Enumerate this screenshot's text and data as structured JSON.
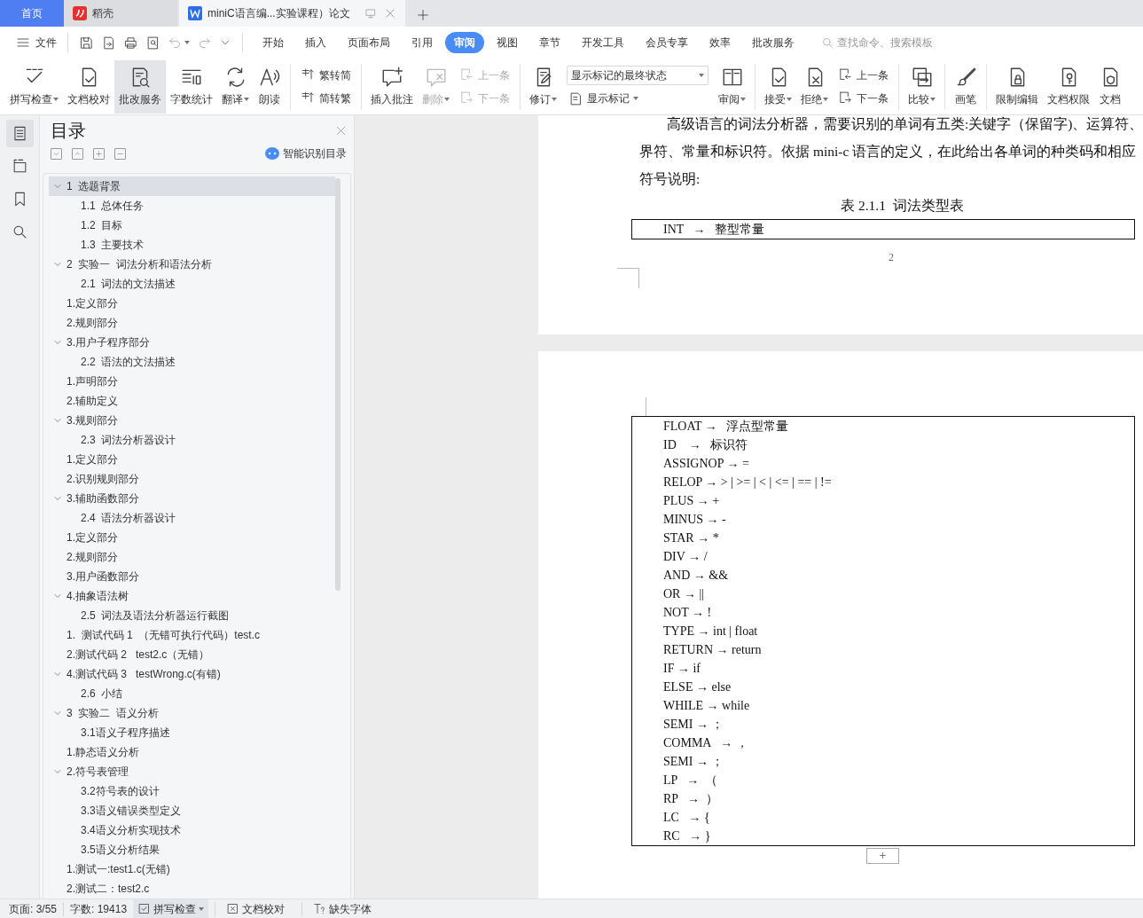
{
  "tabs": [
    {
      "kind": "home",
      "label": "首页",
      "selected": false
    },
    {
      "kind": "app",
      "label": "稻壳",
      "selected": false
    },
    {
      "kind": "doc",
      "label": "miniC语言编...实验课程）论文",
      "selected": true
    }
  ],
  "menu": {
    "file": "文件",
    "items": [
      {
        "label": "开始",
        "selected": false
      },
      {
        "label": "插入",
        "selected": false
      },
      {
        "label": "页面布局",
        "selected": false
      },
      {
        "label": "引用",
        "selected": false
      },
      {
        "label": "审阅",
        "selected": true
      },
      {
        "label": "视图",
        "selected": false
      },
      {
        "label": "章节",
        "selected": false
      },
      {
        "label": "开发工具",
        "selected": false
      },
      {
        "label": "会员专享",
        "selected": false
      },
      {
        "label": "效率",
        "selected": false
      },
      {
        "label": "批改服务",
        "selected": false
      }
    ],
    "search": {
      "placeholder": "查找命令、搜索模板"
    }
  },
  "ribbon": [
    {
      "kind": "large",
      "label": "拼写检查",
      "dropdown": true,
      "disabled": false,
      "selected": false
    },
    {
      "kind": "large",
      "label": "文档校对",
      "dropdown": false,
      "disabled": false,
      "selected": false
    },
    {
      "kind": "large",
      "label": "批改服务",
      "dropdown": false,
      "disabled": false,
      "selected": true
    },
    {
      "kind": "large",
      "label": "字数统计",
      "dropdown": false,
      "disabled": false,
      "selected": false
    },
    {
      "kind": "large",
      "label": "翻译",
      "dropdown": true,
      "disabled": false,
      "selected": false
    },
    {
      "kind": "large",
      "label": "朗读",
      "dropdown": false,
      "disabled": false,
      "selected": false
    },
    {
      "kind": "separator"
    },
    {
      "kind": "pair",
      "items": [
        {
          "label": "繁转简",
          "disabled": false
        },
        {
          "label": "简转繁",
          "disabled": false
        }
      ]
    },
    {
      "kind": "separator"
    },
    {
      "kind": "large",
      "label": "插入批注",
      "dropdown": false,
      "disabled": false,
      "selected": false
    },
    {
      "kind": "large",
      "label": "删除",
      "dropdown": true,
      "disabled": true,
      "selected": false
    },
    {
      "kind": "pair",
      "items": [
        {
          "label": "上一条",
          "disabled": true
        },
        {
          "label": "下一条",
          "disabled": true
        }
      ]
    },
    {
      "kind": "separator"
    },
    {
      "kind": "large",
      "label": "修订",
      "dropdown": true,
      "disabled": false,
      "selected": false
    },
    {
      "kind": "select",
      "value": "显示标记的最终状态",
      "label": "显示标记",
      "dropdown": true
    },
    {
      "kind": "large",
      "label": "审阅",
      "dropdown": true,
      "disabled": false,
      "selected": false
    },
    {
      "kind": "separator"
    },
    {
      "kind": "large",
      "label": "接受",
      "dropdown": true,
      "disabled": false,
      "selected": false
    },
    {
      "kind": "large",
      "label": "拒绝",
      "dropdown": true,
      "disabled": false,
      "selected": false
    },
    {
      "kind": "pair",
      "items": [
        {
          "label": "上一条",
          "disabled": false
        },
        {
          "label": "下一条",
          "disabled": false
        }
      ]
    },
    {
      "kind": "separator"
    },
    {
      "kind": "large",
      "label": "比较",
      "dropdown": true,
      "disabled": false,
      "selected": false
    },
    {
      "kind": "separator"
    },
    {
      "kind": "large",
      "label": "画笔",
      "dropdown": false,
      "disabled": false,
      "selected": false
    },
    {
      "kind": "separator"
    },
    {
      "kind": "large",
      "label": "限制编辑",
      "dropdown": false,
      "disabled": false,
      "selected": false
    },
    {
      "kind": "large",
      "label": "文档权限",
      "dropdown": false,
      "disabled": false,
      "selected": false
    },
    {
      "kind": "large",
      "label": "文档",
      "dropdown": false,
      "disabled": false,
      "selected": false
    }
  ],
  "side_icons": [
    {
      "selected": true
    },
    {
      "selected": false
    },
    {
      "selected": false
    },
    {
      "selected": false
    }
  ],
  "toc": {
    "title": "目录",
    "smart_button": "智能识别目录",
    "items": [
      {
        "label": "1  选题背景",
        "selected": true,
        "expanded": true,
        "children": [
          {
            "label": "1.1  总体任务",
            "selected": false
          },
          {
            "label": "1.2  目标",
            "selected": false
          },
          {
            "label": "1.3  主要技术",
            "selected": false
          }
        ]
      },
      {
        "label": "2  实验一  词法分析和语法分析",
        "selected": false,
        "expanded": true,
        "children": [
          {
            "label": "2.1  词法的文法描述",
            "selected": false
          }
        ]
      },
      {
        "label": "1.定义部分",
        "selected": false
      },
      {
        "label": "2.规则部分",
        "selected": false
      },
      {
        "label": "3.用户子程序部分",
        "selected": false,
        "expanded": true,
        "children": [
          {
            "label": "2.2  语法的文法描述",
            "selected": false
          }
        ]
      },
      {
        "label": "1.声明部分",
        "selected": false
      },
      {
        "label": "2.辅助定义",
        "selected": false
      },
      {
        "label": "3.规则部分",
        "selected": false,
        "expanded": true,
        "children": [
          {
            "label": "2.3  词法分析器设计",
            "selected": false
          }
        ]
      },
      {
        "label": "1.定义部分",
        "selected": false
      },
      {
        "label": "2.识别规则部分",
        "selected": false
      },
      {
        "label": "3.辅助函数部分",
        "selected": false,
        "expanded": true,
        "children": [
          {
            "label": "2.4  语法分析器设计",
            "selected": false
          }
        ]
      },
      {
        "label": "1.定义部分",
        "selected": false
      },
      {
        "label": "2.规则部分",
        "selected": false
      },
      {
        "label": "3.用户函数部分",
        "selected": false
      },
      {
        "label": "4.抽象语法树",
        "selected": false,
        "expanded": true,
        "children": [
          {
            "label": "2.5  词法及语法分析器运行截图",
            "selected": false
          }
        ]
      },
      {
        "label": "1.  测试代码 1  （无错可执行代码）test.c",
        "selected": false
      },
      {
        "label": "2.测试代码 2   test2.c（无错）",
        "selected": false
      },
      {
        "label": "4.测试代码 3   testWrong.c(有错)",
        "selected": false,
        "expanded": true,
        "children": [
          {
            "label": "2.6  小结",
            "selected": false
          }
        ]
      },
      {
        "label": "3  实验二  语义分析",
        "selected": false,
        "expanded": true,
        "children": [
          {
            "label": "3.1语义子程序描述",
            "selected": false
          }
        ]
      },
      {
        "label": "1.静态语义分析",
        "selected": false
      },
      {
        "label": "2.符号表管理",
        "selected": false,
        "expanded": true,
        "children": [
          {
            "label": "3.2符号表的设计",
            "selected": false
          },
          {
            "label": "3.3语义错误类型定义",
            "selected": false
          },
          {
            "label": "3.4语义分析实现技术",
            "selected": false
          },
          {
            "label": "3.5语义分析结果",
            "selected": false
          }
        ]
      },
      {
        "label": "1.测试一:test1.c(无错)",
        "selected": false
      },
      {
        "label": "2.测试二：test2.c",
        "selected": false
      }
    ]
  },
  "document": {
    "paragraph": [
      "高级语言的词法分析器，需要识别的单词有五类:关键字（保留字)、运算符、",
      "界符、常量和标识符。依据 mini-c 语言的定义，在此给出各单词的种类码和相应",
      "符号说明:"
    ],
    "caption": "表 2.1.1  词法类型表",
    "first_table": [
      "INT   →   整型常量"
    ],
    "page_number": "2",
    "second_table": [
      "FLOAT →   浮点型常量",
      "ID    →   标识符",
      "ASSIGNOP → =",
      "RELOP → > | >= | < | <= | == | !=",
      "PLUS → +",
      "MINUS → -",
      "STAR → *",
      "DIV → /",
      "AND → &&",
      "OR → ||",
      "NOT → !",
      "TYPE → int | float",
      "RETURN → return",
      "IF → if",
      "ELSE → else",
      "WHILE → while",
      "SEMI → ；",
      "COMMA   → ，",
      "SEMI → ；",
      "LP   →  （",
      "RP   →  ）",
      "LC   → {",
      "RC   → }"
    ],
    "add_button": "+"
  },
  "status_bar": {
    "page": "页面: 3/55",
    "words": "字数: 19413",
    "spell": "拼写检查",
    "proof": "文档校对",
    "fonts": "缺失字体"
  }
}
